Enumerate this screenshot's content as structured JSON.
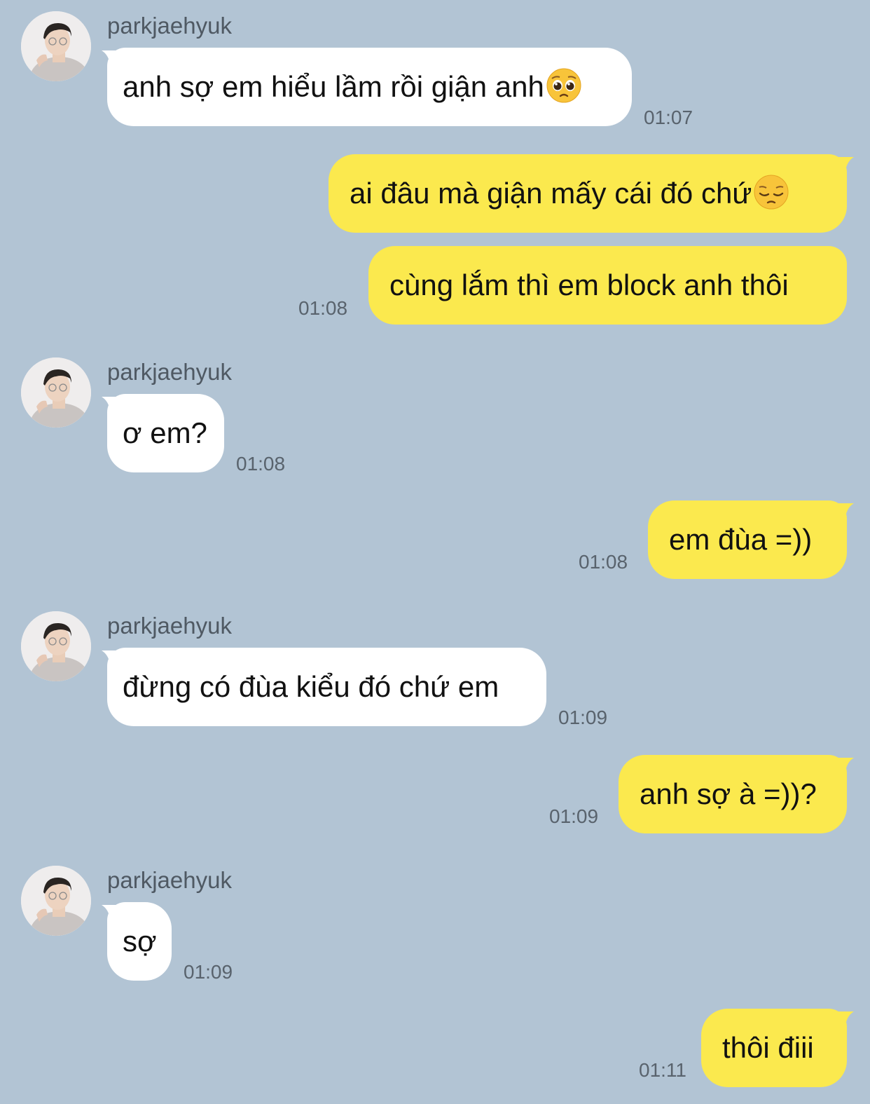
{
  "colors": {
    "background": "#b2c4d4",
    "incoming_bubble": "#ffffff",
    "outgoing_bubble": "#fbe94e",
    "text": "#111111",
    "meta_text": "#59636d"
  },
  "messages": [
    {
      "sender": "parkjaehyuk",
      "text": "anh sợ em hiểu lầm rồi giận anh",
      "emoji": "pleading-face-icon",
      "time": "01:07"
    },
    {
      "text": "ai đâu mà giận mấy cái đó chứ",
      "emoji": "pensive-face-icon"
    },
    {
      "text": "cùng lắm thì em block anh thôi",
      "time": "01:08"
    },
    {
      "sender": "parkjaehyuk",
      "text": "ơ em?",
      "time": "01:08"
    },
    {
      "text": "em đùa =))",
      "time": "01:08"
    },
    {
      "sender": "parkjaehyuk",
      "text": "đừng có đùa kiểu đó chứ em",
      "time": "01:09"
    },
    {
      "text": "anh sợ à =))?",
      "time": "01:09"
    },
    {
      "sender": "parkjaehyuk",
      "text": "sợ",
      "time": "01:09"
    },
    {
      "text": "thôi điii",
      "time": "01:11"
    }
  ]
}
